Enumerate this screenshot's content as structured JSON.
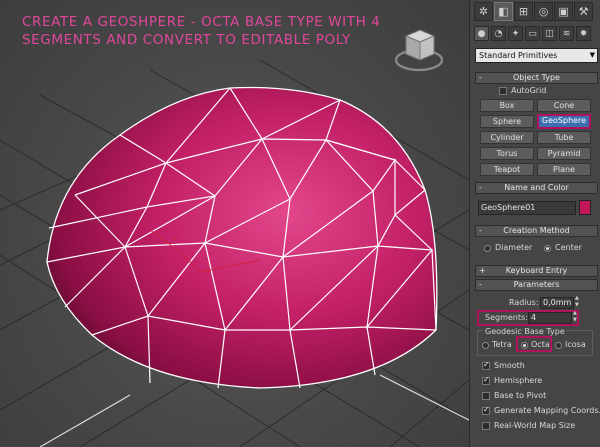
{
  "caption": {
    "line1": "CREATE A GEOSHPERE - OCTA BASE TYPE WITH 4",
    "line2": "SEGMENTS AND CONVERT TO EDITABLE POLY"
  },
  "colors": {
    "accent": "#e0479b",
    "highlight": "#b0125e",
    "object": "#c2185b"
  },
  "panel": {
    "tabs": [
      "create-icon",
      "modify-icon",
      "hierarchy-icon",
      "motion-icon",
      "display-icon",
      "utilities-icon"
    ],
    "subtabs": [
      "geometry-icon",
      "shapes-icon",
      "lights-icon",
      "cameras-icon",
      "helpers-icon",
      "spacewarps-icon",
      "systems-icon"
    ],
    "dropdown_value": "Standard Primitives",
    "object_type": {
      "title": "Object Type",
      "autogrid": "AutoGrid",
      "buttons": [
        "Box",
        "Cone",
        "Sphere",
        "GeoSphere",
        "Cylinder",
        "Tube",
        "Torus",
        "Pyramid",
        "Teapot",
        "Plane"
      ],
      "selected": "GeoSphere"
    },
    "name_color": {
      "title": "Name and Color",
      "name_value": "GeoSphere01"
    },
    "creation_method": {
      "title": "Creation Method",
      "options": [
        "Diameter",
        "Center"
      ],
      "selected": "Center"
    },
    "keyboard_entry": {
      "title": "Keyboard Entry"
    },
    "parameters": {
      "title": "Parameters",
      "radius_label": "Radius:",
      "radius_value": "0,0mm",
      "segments_label": "Segments:",
      "segments_value": "4",
      "base_type_title": "Geodesic Base Type",
      "base_types": [
        "Tetra",
        "Octa",
        "Icosa"
      ],
      "base_type_selected": "Octa",
      "smooth": "Smooth",
      "hemisphere": "Hemisphere",
      "base_to_pivot": "Base to Pivot",
      "gen_mapping": "Generate Mapping Coords.",
      "real_world": "Real-World Map Size"
    },
    "rollout_signs": {
      "open": "-",
      "closed": "+"
    }
  }
}
